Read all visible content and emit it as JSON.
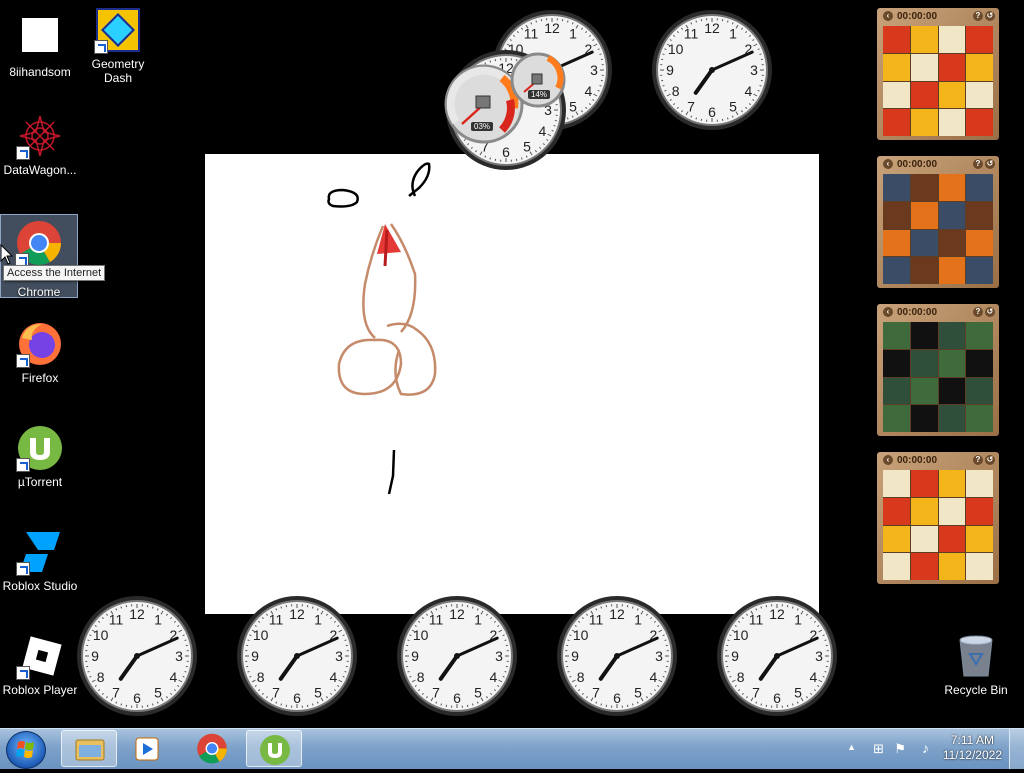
{
  "desktop_icons": [
    {
      "label": "8iihandsom",
      "icon": "blank-image-icon"
    },
    {
      "label": "Geometry Dash",
      "icon": "geometry-dash-icon",
      "line2": ""
    },
    {
      "label": "DataWagon...",
      "icon": "datawagon-icon"
    },
    {
      "label": "Chrome",
      "icon": "chrome-icon"
    },
    {
      "label": "Firefox",
      "icon": "firefox-icon"
    },
    {
      "label": "µTorrent",
      "icon": "utorrent-icon"
    },
    {
      "label": "Roblox Studio",
      "icon": "roblox-studio-icon"
    },
    {
      "label": "Roblox Player",
      "icon": "roblox-player-icon"
    },
    {
      "label": "Recycle Bin",
      "icon": "recycle-bin-icon"
    }
  ],
  "geometry_dash": {
    "line1": "Geometry",
    "line2": "Dash"
  },
  "tooltip": "Access the Internet",
  "meter_gadget": {
    "cpu": "03%",
    "memory": "14%"
  },
  "puzzles": [
    {
      "timer": "00:00:00"
    },
    {
      "timer": "00:00:00"
    },
    {
      "timer": "00:00:00"
    },
    {
      "timer": "00:00:00"
    }
  ],
  "taskbar": {
    "pinned": [
      "windows-explorer-icon",
      "media-player-icon",
      "chrome-icon",
      "utorrent-icon"
    ],
    "time": "7:11 AM",
    "date": "11/12/2022"
  },
  "colors": {
    "desktop": "#000000",
    "taskbar": "#7ea2c9",
    "accent": "#1d5bb6"
  }
}
